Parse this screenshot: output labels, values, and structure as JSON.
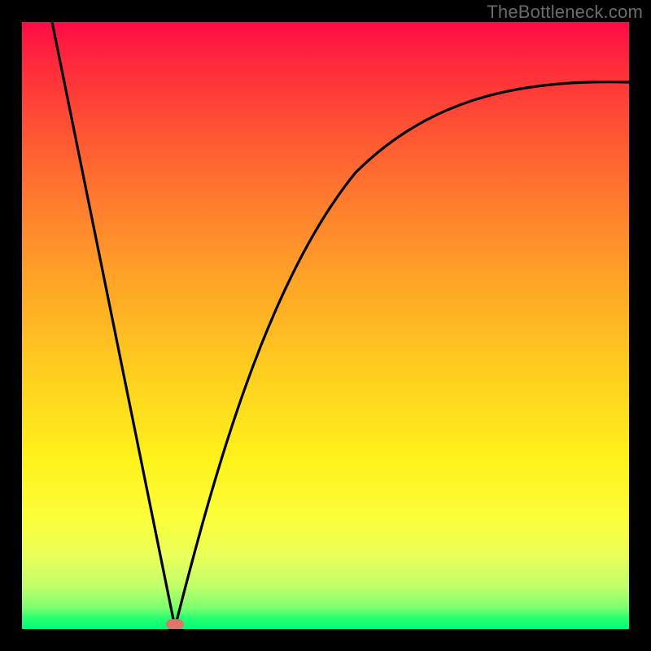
{
  "watermark": "TheBottleneck.com",
  "colors": {
    "frame": "#000000",
    "gradient_top": "#ff0b46",
    "gradient_bottom": "#00ff76",
    "curve": "#000000",
    "marker": "#d9776a",
    "watermark_text": "#6b6b6b"
  },
  "chart_data": {
    "type": "line",
    "title": "",
    "xlabel": "",
    "ylabel": "",
    "xlim": [
      0,
      100
    ],
    "ylim": [
      0,
      100
    ],
    "series": [
      {
        "name": "left-descent",
        "x": [
          5,
          25
        ],
        "values": [
          100,
          0
        ]
      },
      {
        "name": "right-curve",
        "x": [
          25,
          30,
          35,
          40,
          45,
          50,
          55,
          60,
          65,
          70,
          75,
          80,
          85,
          90,
          95,
          100
        ],
        "values": [
          0,
          20,
          36,
          49,
          59,
          67,
          73,
          77.5,
          81,
          83.5,
          85.5,
          87,
          88,
          89,
          89.5,
          90
        ]
      }
    ],
    "annotations": [
      {
        "name": "min-marker",
        "x": 25,
        "y": 0
      }
    ]
  }
}
